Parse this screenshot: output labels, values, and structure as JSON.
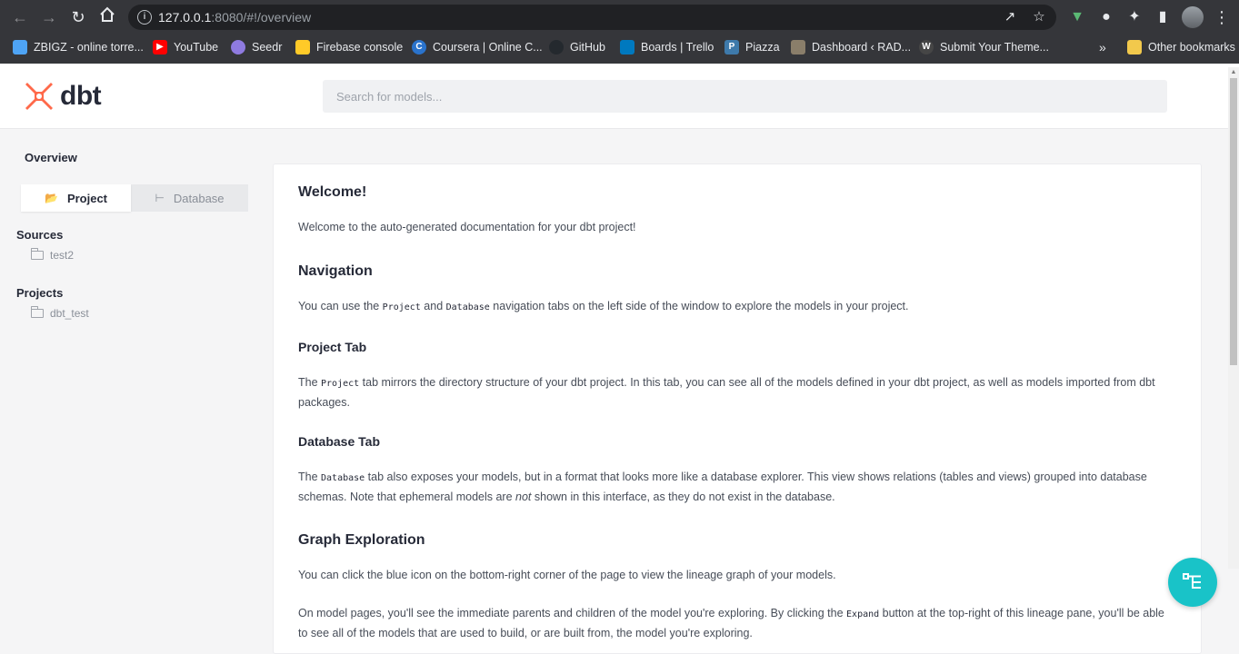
{
  "browser": {
    "url_host": "127.0.0.1",
    "url_rest": ":8080/#!/overview",
    "bookmarks": [
      {
        "label": "ZBIGZ - online torre...",
        "icon": "cloud-icon",
        "color": "#4ea4f5"
      },
      {
        "label": "YouTube",
        "icon": "youtube-icon",
        "color": "#ff0000"
      },
      {
        "label": "Seedr",
        "icon": "seedr-icon",
        "color": "#8f7be0"
      },
      {
        "label": "Firebase console",
        "icon": "firebase-icon",
        "color": "#ffca28"
      },
      {
        "label": "Coursera | Online C...",
        "icon": "coursera-icon",
        "color": "#2a73cc"
      },
      {
        "label": "GitHub",
        "icon": "github-icon",
        "color": "#24292e"
      },
      {
        "label": "Boards | Trello",
        "icon": "trello-icon",
        "color": "#0079bf"
      },
      {
        "label": "Piazza",
        "icon": "piazza-icon",
        "color": "#3e7aab"
      },
      {
        "label": "Dashboard ‹ RAD...",
        "icon": "dashboard-icon",
        "color": "#8a7e6a"
      },
      {
        "label": "Submit Your Theme...",
        "icon": "wordpress-icon",
        "color": "#464646"
      }
    ],
    "overflow_label": "»",
    "other_bookmarks": "Other bookmarks"
  },
  "header": {
    "logo_text": "dbt",
    "search_placeholder": "Search for models..."
  },
  "sidebar": {
    "title": "Overview",
    "tabs": {
      "project": "Project",
      "database": "Database"
    },
    "sources_label": "Sources",
    "sources": [
      "test2"
    ],
    "projects_label": "Projects",
    "projects": [
      "dbt_test"
    ]
  },
  "content": {
    "welcome_title": "Welcome!",
    "welcome_text": "Welcome to the auto-generated documentation for your dbt project!",
    "nav_title": "Navigation",
    "nav_text_1": "You can use the ",
    "nav_code_1": "Project",
    "nav_text_2": " and ",
    "nav_code_2": "Database",
    "nav_text_3": " navigation tabs on the left side of the window to explore the models in your project.",
    "project_tab_title": "Project Tab",
    "project_text_1": "The ",
    "project_code": "Project",
    "project_text_2": " tab mirrors the directory structure of your dbt project. In this tab, you can see all of the models defined in your dbt project, as well as models imported from dbt packages.",
    "database_tab_title": "Database Tab",
    "database_text_1": "The ",
    "database_code": "Database",
    "database_text_2": " tab also exposes your models, but in a format that looks more like a database explorer. This view shows relations (tables and views) grouped into database schemas. Note that ephemeral models are ",
    "database_em": "not",
    "database_text_3": " shown in this interface, as they do not exist in the database.",
    "graph_title": "Graph Exploration",
    "graph_text": "You can click the blue icon on the bottom-right corner of the page to view the lineage graph of your models.",
    "graph_text2_1": "On model pages, you'll see the immediate parents and children of the model you're exploring. By clicking the ",
    "graph_code": "Expand",
    "graph_text2_2": " button at the top-right of this lineage pane, you'll be able to see all of the models that are used to build, or are built from, the model you're exploring."
  },
  "colors": {
    "brand": "#ff694a",
    "fab": "#19c3c8"
  }
}
